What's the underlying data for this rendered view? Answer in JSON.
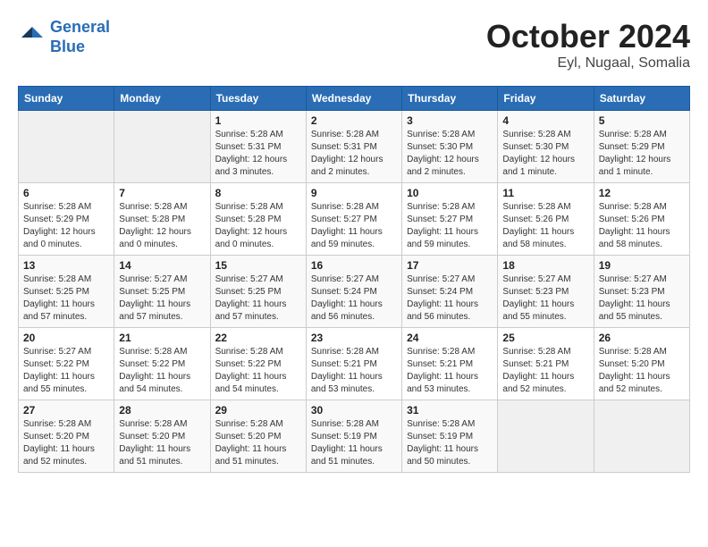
{
  "logo": {
    "line1": "General",
    "line2": "Blue"
  },
  "title": "October 2024",
  "subtitle": "Eyl, Nugaal, Somalia",
  "headers": [
    "Sunday",
    "Monday",
    "Tuesday",
    "Wednesday",
    "Thursday",
    "Friday",
    "Saturday"
  ],
  "weeks": [
    [
      {
        "num": "",
        "sunrise": "",
        "sunset": "",
        "daylight": "",
        "empty": true
      },
      {
        "num": "",
        "sunrise": "",
        "sunset": "",
        "daylight": "",
        "empty": true
      },
      {
        "num": "1",
        "sunrise": "Sunrise: 5:28 AM",
        "sunset": "Sunset: 5:31 PM",
        "daylight": "Daylight: 12 hours and 3 minutes."
      },
      {
        "num": "2",
        "sunrise": "Sunrise: 5:28 AM",
        "sunset": "Sunset: 5:31 PM",
        "daylight": "Daylight: 12 hours and 2 minutes."
      },
      {
        "num": "3",
        "sunrise": "Sunrise: 5:28 AM",
        "sunset": "Sunset: 5:30 PM",
        "daylight": "Daylight: 12 hours and 2 minutes."
      },
      {
        "num": "4",
        "sunrise": "Sunrise: 5:28 AM",
        "sunset": "Sunset: 5:30 PM",
        "daylight": "Daylight: 12 hours and 1 minute."
      },
      {
        "num": "5",
        "sunrise": "Sunrise: 5:28 AM",
        "sunset": "Sunset: 5:29 PM",
        "daylight": "Daylight: 12 hours and 1 minute."
      }
    ],
    [
      {
        "num": "6",
        "sunrise": "Sunrise: 5:28 AM",
        "sunset": "Sunset: 5:29 PM",
        "daylight": "Daylight: 12 hours and 0 minutes."
      },
      {
        "num": "7",
        "sunrise": "Sunrise: 5:28 AM",
        "sunset": "Sunset: 5:28 PM",
        "daylight": "Daylight: 12 hours and 0 minutes."
      },
      {
        "num": "8",
        "sunrise": "Sunrise: 5:28 AM",
        "sunset": "Sunset: 5:28 PM",
        "daylight": "Daylight: 12 hours and 0 minutes."
      },
      {
        "num": "9",
        "sunrise": "Sunrise: 5:28 AM",
        "sunset": "Sunset: 5:27 PM",
        "daylight": "Daylight: 11 hours and 59 minutes."
      },
      {
        "num": "10",
        "sunrise": "Sunrise: 5:28 AM",
        "sunset": "Sunset: 5:27 PM",
        "daylight": "Daylight: 11 hours and 59 minutes."
      },
      {
        "num": "11",
        "sunrise": "Sunrise: 5:28 AM",
        "sunset": "Sunset: 5:26 PM",
        "daylight": "Daylight: 11 hours and 58 minutes."
      },
      {
        "num": "12",
        "sunrise": "Sunrise: 5:28 AM",
        "sunset": "Sunset: 5:26 PM",
        "daylight": "Daylight: 11 hours and 58 minutes."
      }
    ],
    [
      {
        "num": "13",
        "sunrise": "Sunrise: 5:28 AM",
        "sunset": "Sunset: 5:25 PM",
        "daylight": "Daylight: 11 hours and 57 minutes."
      },
      {
        "num": "14",
        "sunrise": "Sunrise: 5:27 AM",
        "sunset": "Sunset: 5:25 PM",
        "daylight": "Daylight: 11 hours and 57 minutes."
      },
      {
        "num": "15",
        "sunrise": "Sunrise: 5:27 AM",
        "sunset": "Sunset: 5:25 PM",
        "daylight": "Daylight: 11 hours and 57 minutes."
      },
      {
        "num": "16",
        "sunrise": "Sunrise: 5:27 AM",
        "sunset": "Sunset: 5:24 PM",
        "daylight": "Daylight: 11 hours and 56 minutes."
      },
      {
        "num": "17",
        "sunrise": "Sunrise: 5:27 AM",
        "sunset": "Sunset: 5:24 PM",
        "daylight": "Daylight: 11 hours and 56 minutes."
      },
      {
        "num": "18",
        "sunrise": "Sunrise: 5:27 AM",
        "sunset": "Sunset: 5:23 PM",
        "daylight": "Daylight: 11 hours and 55 minutes."
      },
      {
        "num": "19",
        "sunrise": "Sunrise: 5:27 AM",
        "sunset": "Sunset: 5:23 PM",
        "daylight": "Daylight: 11 hours and 55 minutes."
      }
    ],
    [
      {
        "num": "20",
        "sunrise": "Sunrise: 5:27 AM",
        "sunset": "Sunset: 5:22 PM",
        "daylight": "Daylight: 11 hours and 55 minutes."
      },
      {
        "num": "21",
        "sunrise": "Sunrise: 5:28 AM",
        "sunset": "Sunset: 5:22 PM",
        "daylight": "Daylight: 11 hours and 54 minutes."
      },
      {
        "num": "22",
        "sunrise": "Sunrise: 5:28 AM",
        "sunset": "Sunset: 5:22 PM",
        "daylight": "Daylight: 11 hours and 54 minutes."
      },
      {
        "num": "23",
        "sunrise": "Sunrise: 5:28 AM",
        "sunset": "Sunset: 5:21 PM",
        "daylight": "Daylight: 11 hours and 53 minutes."
      },
      {
        "num": "24",
        "sunrise": "Sunrise: 5:28 AM",
        "sunset": "Sunset: 5:21 PM",
        "daylight": "Daylight: 11 hours and 53 minutes."
      },
      {
        "num": "25",
        "sunrise": "Sunrise: 5:28 AM",
        "sunset": "Sunset: 5:21 PM",
        "daylight": "Daylight: 11 hours and 52 minutes."
      },
      {
        "num": "26",
        "sunrise": "Sunrise: 5:28 AM",
        "sunset": "Sunset: 5:20 PM",
        "daylight": "Daylight: 11 hours and 52 minutes."
      }
    ],
    [
      {
        "num": "27",
        "sunrise": "Sunrise: 5:28 AM",
        "sunset": "Sunset: 5:20 PM",
        "daylight": "Daylight: 11 hours and 52 minutes."
      },
      {
        "num": "28",
        "sunrise": "Sunrise: 5:28 AM",
        "sunset": "Sunset: 5:20 PM",
        "daylight": "Daylight: 11 hours and 51 minutes."
      },
      {
        "num": "29",
        "sunrise": "Sunrise: 5:28 AM",
        "sunset": "Sunset: 5:20 PM",
        "daylight": "Daylight: 11 hours and 51 minutes."
      },
      {
        "num": "30",
        "sunrise": "Sunrise: 5:28 AM",
        "sunset": "Sunset: 5:19 PM",
        "daylight": "Daylight: 11 hours and 51 minutes."
      },
      {
        "num": "31",
        "sunrise": "Sunrise: 5:28 AM",
        "sunset": "Sunset: 5:19 PM",
        "daylight": "Daylight: 11 hours and 50 minutes."
      },
      {
        "num": "",
        "sunrise": "",
        "sunset": "",
        "daylight": "",
        "empty": true
      },
      {
        "num": "",
        "sunrise": "",
        "sunset": "",
        "daylight": "",
        "empty": true
      }
    ]
  ]
}
